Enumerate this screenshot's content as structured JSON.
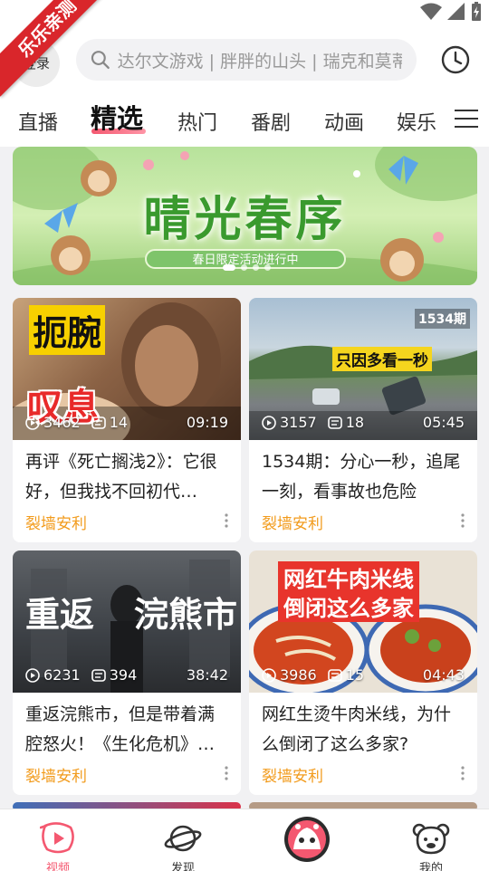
{
  "ribbon": "乐乐亲测",
  "header": {
    "login_label": "登录",
    "search_placeholder": "达尔文游戏 | 胖胖的山头 | 瑞克和莫蒂",
    "history_icon": "clock-icon"
  },
  "tabs": [
    {
      "label": "直播"
    },
    {
      "label": "精选",
      "active": true
    },
    {
      "label": "热门"
    },
    {
      "label": "番剧"
    },
    {
      "label": "动画"
    },
    {
      "label": "娱乐"
    }
  ],
  "banner": {
    "title": "晴光春序",
    "subtitle": "春日限定活动进行中",
    "slide_count": 4,
    "active_slide": 0
  },
  "videos": [
    {
      "thumb_text_top": "扼腕",
      "thumb_text_bottom": "叹息",
      "plays": "3462",
      "comments": "14",
      "duration": "09:19",
      "title": "再评《死亡搁浅2》：它很好，但我找不回初代…",
      "author": "裂墙安利"
    },
    {
      "thumb_text_top": "只因多看一秒",
      "thumb_tag": "1534期",
      "plays": "3157",
      "comments": "18",
      "duration": "05:45",
      "title": "1534期：分心一秒，追尾一刻，看事故也危险",
      "author": "裂墙安利"
    },
    {
      "thumb_text_top": "重返",
      "thumb_text_bottom": "浣熊市",
      "plays": "6231",
      "comments": "394",
      "duration": "38:42",
      "title": "重返浣熊市，但是带着满腔怒火！《生化危机》…",
      "author": "裂墙安利"
    },
    {
      "thumb_text_top": "网红牛肉米线",
      "thumb_text_bottom": "倒闭这么多家",
      "plays": "3986",
      "comments": "15",
      "duration": "04:43",
      "title": "网红生烫牛肉米线，为什么倒闭了这么多家?",
      "author": "裂墙安利"
    }
  ],
  "bottom_nav": [
    {
      "label": "视频",
      "icon": "video-icon",
      "active": true
    },
    {
      "label": "发现",
      "icon": "planet-icon"
    },
    {
      "label": "",
      "icon": "center-mascot-icon"
    },
    {
      "label": "我的",
      "icon": "bear-face-icon"
    }
  ],
  "colors": {
    "accent": "#f45870",
    "author": "#f29b1c",
    "ribbon": "#d9262b"
  }
}
